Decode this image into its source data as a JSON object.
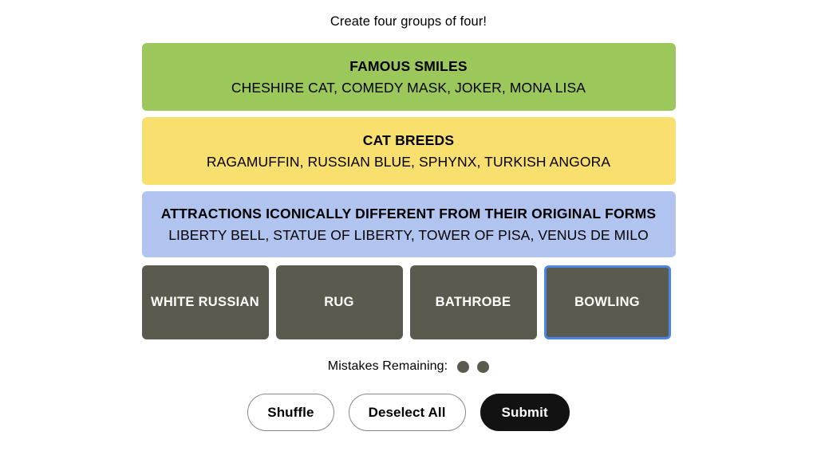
{
  "prompt": "Create four groups of four!",
  "colors": {
    "green": "#9cc75a",
    "yellow": "#f9df6d",
    "blue": "#b0c4ef",
    "tile": "#5a5a4e",
    "focus_ring": "#4a86e8",
    "submit_bg": "#121212"
  },
  "categories": [
    {
      "title": "FAMOUS SMILES",
      "members": "CHESHIRE CAT, COMEDY MASK, JOKER, MONA LISA",
      "color": "#9cc75a",
      "color_name": "green"
    },
    {
      "title": "CAT BREEDS",
      "members": "RAGAMUFFIN, RUSSIAN BLUE, SPHYNX, TURKISH ANGORA",
      "color": "#f9df6d",
      "color_name": "yellow"
    },
    {
      "title": "ATTRACTIONS ICONICALLY DIFFERENT FROM THEIR ORIGINAL FORMS",
      "members": "LIBERTY BELL, STATUE OF LIBERTY, TOWER OF PISA, VENUS DE MILO",
      "color": "#b0c4ef",
      "color_name": "blue"
    }
  ],
  "tiles": [
    {
      "label": "WHITE RUSSIAN",
      "focused": false
    },
    {
      "label": "RUG",
      "focused": false
    },
    {
      "label": "BATHROBE",
      "focused": false
    },
    {
      "label": "BOWLING",
      "focused": true
    }
  ],
  "mistakes": {
    "label": "Mistakes Remaining:",
    "remaining": 2,
    "dots": [
      "mistake-dot",
      "mistake-dot"
    ]
  },
  "actions": {
    "shuffle": "Shuffle",
    "deselect": "Deselect All",
    "submit": "Submit"
  }
}
